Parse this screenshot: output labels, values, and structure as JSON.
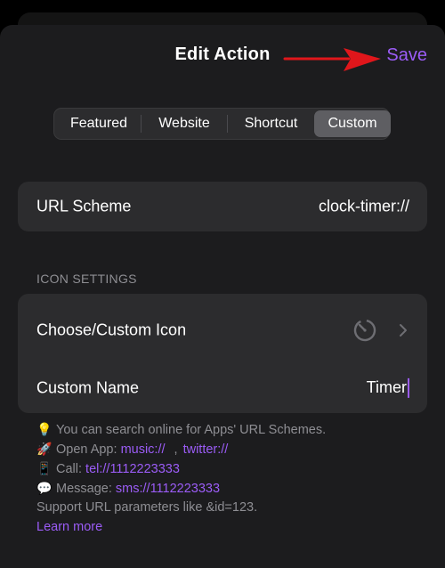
{
  "header": {
    "title": "Edit Action",
    "save_label": "Save"
  },
  "segments": [
    "Featured",
    "Website",
    "Shortcut",
    "Custom"
  ],
  "selected_segment": "Custom",
  "url_scheme": {
    "label": "URL Scheme",
    "value": "clock-timer://"
  },
  "icon_settings": {
    "section_title": "ICON SETTINGS",
    "choose_icon_label": "Choose/Custom Icon",
    "custom_name_label": "Custom Name",
    "custom_name_value": "Timer"
  },
  "tips": {
    "search_emoji": "💡",
    "search_text": "You can search online for Apps' URL Schemes.",
    "open_emoji": "🚀",
    "open_prefix": "Open App:",
    "open_link_1": "music://",
    "open_sep": ",",
    "open_link_2": "twitter://",
    "call_emoji": "📱",
    "call_prefix": "Call:",
    "call_link": "tel://1112223333",
    "message_emoji": "💬",
    "message_prefix": "Message:",
    "message_link": "sms://1112223333",
    "params_text": "Support URL parameters like &id=123.",
    "learn_more": "Learn more"
  },
  "colors": {
    "accent": "#9b5cf6",
    "annotation_arrow": "#e0161b",
    "background": "#1c1c1e",
    "card": "#2c2c2e"
  },
  "icons": {
    "annotation": "red-arrow-icon",
    "icon_preview": "timer-icon",
    "disclosure": "chevron-right-icon"
  }
}
